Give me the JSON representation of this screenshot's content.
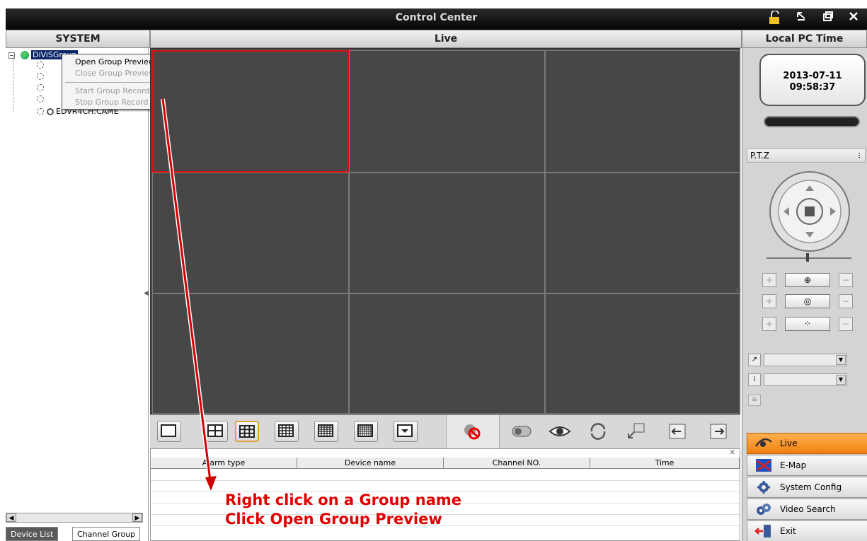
{
  "window": {
    "title": "Control Center"
  },
  "headers": {
    "system": "SYSTEM",
    "live": "Live",
    "local_pc_time": "Local PC Time"
  },
  "tree": {
    "group": "DiViSGroup",
    "visible_channel": "EDVR4CH:CAME"
  },
  "context_menu": {
    "items": [
      {
        "label": "Open Group Preview",
        "enabled": true
      },
      {
        "label": "Close Group Preview",
        "enabled": false
      },
      {
        "label": "Start Group Record",
        "enabled": false
      },
      {
        "label": "Stop Group Record",
        "enabled": false
      }
    ]
  },
  "left_tabs": {
    "device_list": "Device List",
    "channel_group": "Channel Group"
  },
  "clock": {
    "date": "2013-07-11",
    "time": "09:58:37"
  },
  "ptz": {
    "label": "P.T.Z"
  },
  "alarm_table": {
    "columns": [
      "Alarm type",
      "Device name",
      "Channel NO.",
      "Time"
    ]
  },
  "annotation": {
    "line1": "Right click on a Group name",
    "line2": "Click Open Group Preview"
  },
  "nav": {
    "items": [
      {
        "label": "Live",
        "icon": "live-icon",
        "active": true
      },
      {
        "label": "E-Map",
        "icon": "emap-icon",
        "active": false
      },
      {
        "label": "System Config",
        "icon": "gear-icon",
        "active": false
      },
      {
        "label": "Video Search",
        "icon": "video-search-icon",
        "active": false
      },
      {
        "label": "Exit",
        "icon": "exit-icon",
        "active": false
      }
    ]
  },
  "colors": {
    "annotation": "#e00000",
    "active_nav": "#f08010",
    "selected_cell_border": "#e00000"
  }
}
